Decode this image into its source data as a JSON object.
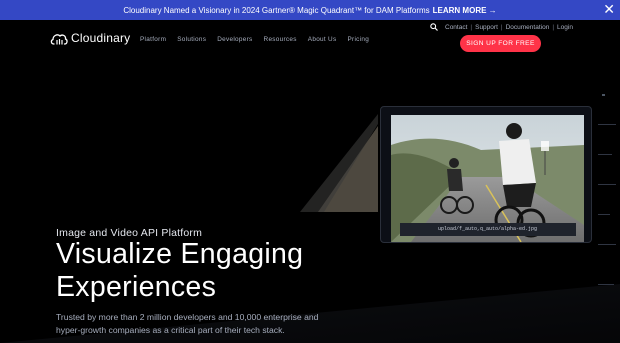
{
  "banner": {
    "text": "Cloudinary Named a Visionary in 2024 Gartner® Magic Quadrant™ for DAM Platforms",
    "cta": "LEARN MORE",
    "arrow": "→",
    "close": "✕"
  },
  "header": {
    "brand": "Cloudinary",
    "nav": [
      "Platform",
      "Solutions",
      "Developers",
      "Resources",
      "About Us",
      "Pricing"
    ],
    "utility": [
      "Contact",
      "Support",
      "Documentation",
      "Login"
    ],
    "signup": "SIGN UP FOR FREE",
    "icons": {
      "logo": "cloud-logo-icon",
      "search": "search-icon",
      "close": "close-icon"
    }
  },
  "hero": {
    "eyebrow": "Image and Video API Platform",
    "title_line1": "Visualize Engaging",
    "title_line2": "Experiences",
    "subtitle": "Trusted by more than 2 million developers and 10,000 enterprise and hyper-growth companies as a critical part of their tech stack.",
    "image_url_text": "upload/f_auto,q_auto/alpha-ed.jpg"
  },
  "colors": {
    "banner_bg": "#3448c5",
    "signup_bg": "#ff3348",
    "page_bg": "#000000",
    "nav_text": "#a7aebe"
  }
}
